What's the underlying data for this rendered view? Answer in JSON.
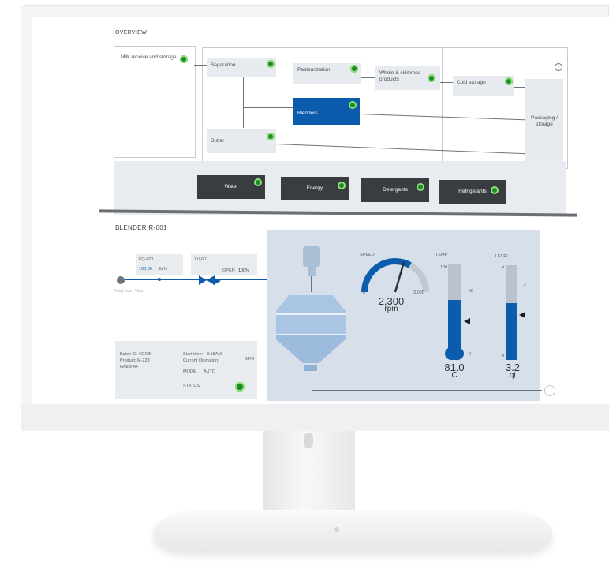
{
  "overview": {
    "title": "OVERVIEW",
    "nodes": {
      "milk": "Milk receive and storage",
      "separation": "Separation",
      "pasteurization": "Pasteurization",
      "whole": "Whole & skimmed products",
      "cold": "Cold storage",
      "blenders": "Blenders",
      "packaging": "Packaging / storage",
      "butter": "Butter"
    },
    "utilities": [
      "Water",
      "Energy",
      "Detergents",
      "Refrigerants"
    ]
  },
  "blender": {
    "title": "BLENDER R-601",
    "fq": {
      "label": "FQ-601",
      "value": "100.00",
      "unit": "lb/hr"
    },
    "xv": {
      "label": "XV-601",
      "status": "OPEN",
      "percent": "100%"
    },
    "feed_label": "Feed from Vats",
    "info": {
      "batch_id": "Batch ID: 6E425",
      "product": "Product: M-223",
      "grade": "Grade A+",
      "start_time_label": "Start time:",
      "start_time": "8:15AM",
      "current_op_label": "Current Operation:",
      "current_op": "STIR",
      "mode_label": "MODE",
      "mode": "AUTO",
      "status_label": "STATUS"
    },
    "speed": {
      "label": "SPEED",
      "value": "2,300",
      "unit": "rpm",
      "min": "0",
      "max": "3,000"
    },
    "temp": {
      "label": "TEMP",
      "value": "81.0",
      "unit": "C",
      "top": "100",
      "mid": "50",
      "bottom": "0"
    },
    "level": {
      "label": "LEVEL",
      "value": "3.2",
      "unit": "qt",
      "top": "4",
      "mid": "2",
      "bottom": "0"
    }
  }
}
